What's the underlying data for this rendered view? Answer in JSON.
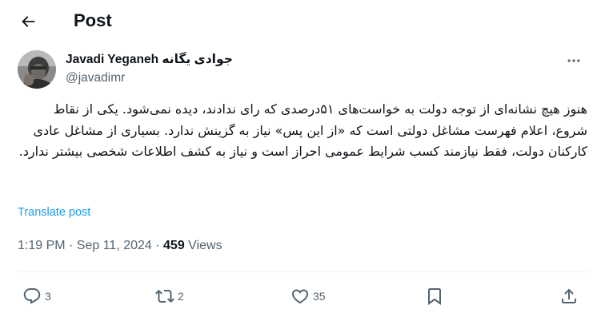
{
  "header": {
    "title": "Post",
    "back_icon": "arrow-left-icon"
  },
  "author": {
    "display_name": "Javadi Yeganeh جوادی یگانه",
    "handle": "@javadimr"
  },
  "post": {
    "text": "هنوز هیچ نشانه‌ای از توجه دولت به خواست‌های ۵۱درصدی که رای ندادند، دیده نمی‌شود. یکی از نقاط شروع، اعلام فهرست مشاغل دولتی است که «از این پس» نیاز به گزینش ندارد. بسیاری از مشاغل عادی کارکنان دولت، فقط نیازمند کسب شرایط عمومی احراز است و نیاز به کشف اطلاعات شخصی بیشتر ندارد.",
    "translate_label": "Translate post",
    "timestamp": "1:19 PM · Sep 11, 2024 · ",
    "views_count": "459",
    "views_label": " Views"
  },
  "actions": {
    "replies": "3",
    "reposts": "2",
    "likes": "35"
  },
  "colors": {
    "link": "#1d9bf0",
    "secondary_text": "#536471",
    "primary_text": "#0f1419"
  }
}
